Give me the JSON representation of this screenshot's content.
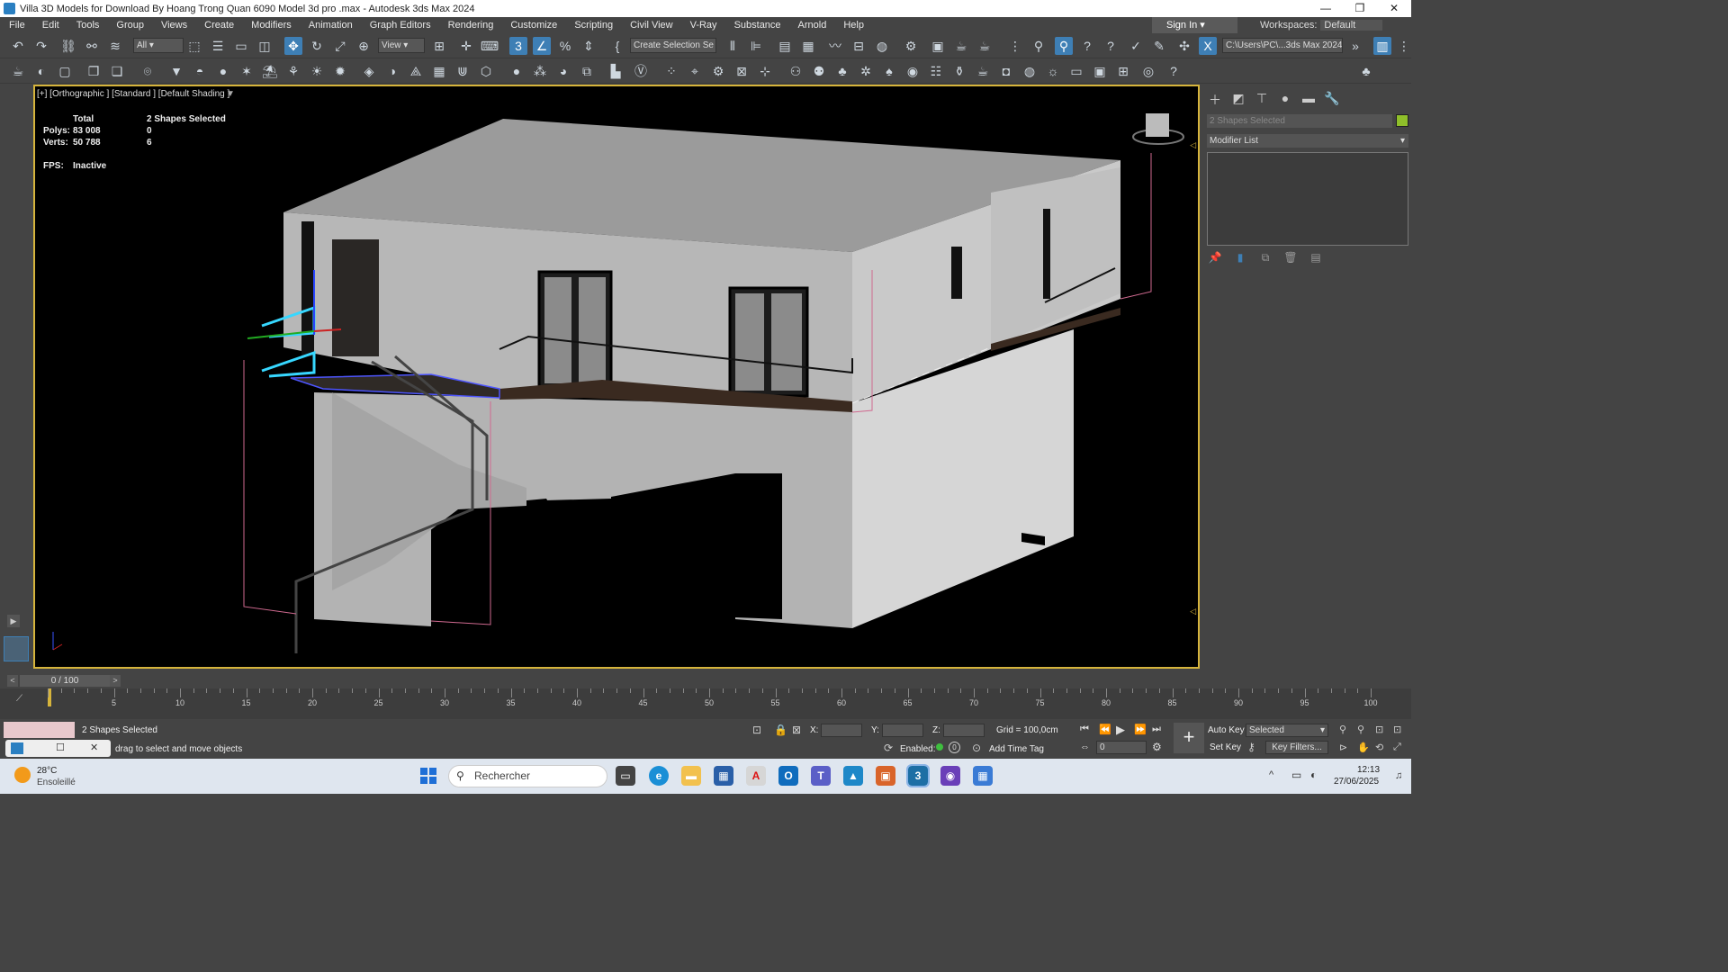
{
  "window": {
    "title": "Villa 3D Models for Download By Hoang Trong Quan 6090 Model 3d pro .max - Autodesk 3ds Max 2024",
    "minimize": "—",
    "maximize": "❐",
    "close": "✕"
  },
  "menu": [
    "File",
    "Edit",
    "Tools",
    "Group",
    "Views",
    "Create",
    "Modifiers",
    "Animation",
    "Graph Editors",
    "Rendering",
    "Customize",
    "Scripting",
    "Civil View",
    "V-Ray",
    "Substance",
    "Arnold",
    "Help"
  ],
  "signin": "Sign In",
  "workspaces": {
    "label": "Workspaces:",
    "value": "Default"
  },
  "toolbar": {
    "selection_filter": "All",
    "reference_coord": "View",
    "named_selection": "Create Selection Se",
    "project_path": "C:\\Users\\PC\\...3ds Max 2024"
  },
  "viewport": {
    "label": "[+] [Orthographic ] [Standard ] [Default Shading ]",
    "stats": {
      "total_label": "Total",
      "selected_label": "2 Shapes Selected",
      "polys_label": "Polys:",
      "polys_total": "83 008",
      "polys_selected": "0",
      "verts_label": "Verts:",
      "verts_total": "50 788",
      "verts_selected": "6",
      "fps_label": "FPS:",
      "fps_value": "Inactive"
    }
  },
  "command_panel": {
    "object_name": "2 Shapes Selected",
    "modifier_list": "Modifier List",
    "color": "#8fbf2a"
  },
  "time_slider": {
    "label": "0 / 100",
    "prev": "<",
    "next": ">"
  },
  "track_ticks": [
    "5",
    "10",
    "15",
    "20",
    "25",
    "30",
    "35",
    "40",
    "45",
    "50",
    "55",
    "60",
    "65",
    "70",
    "75",
    "80",
    "85",
    "90",
    "95",
    "100"
  ],
  "status": {
    "selection": "2 Shapes Selected",
    "prompt": "drag to select and move objects",
    "x_label": "X:",
    "y_label": "Y:",
    "z_label": "Z:",
    "grid": "Grid = 100,0cm",
    "enabled_label": "Enabled:",
    "add_time_tag": "Add Time Tag",
    "auto_key": "Auto Key",
    "set_key": "Set Key",
    "key_mode": "Selected",
    "key_filters": "Key Filters...",
    "frame": "0"
  },
  "taskbar": {
    "temperature": "28°C",
    "weather": "Ensoleillé",
    "search": "Rechercher",
    "time": "12:13",
    "date": "27/06/2025"
  }
}
